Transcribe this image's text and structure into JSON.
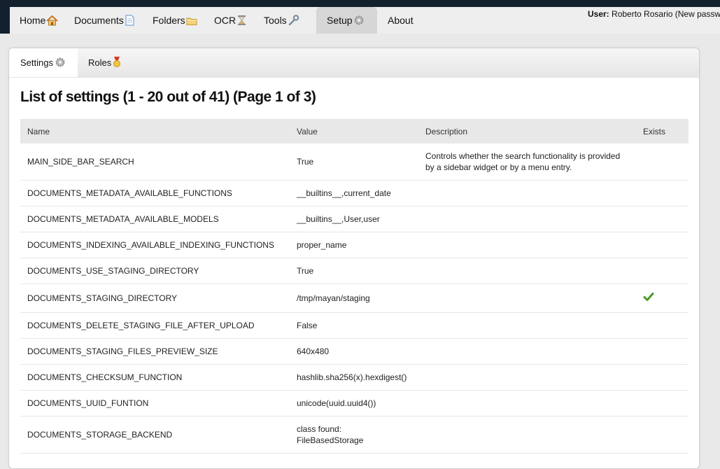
{
  "nav": {
    "items": [
      {
        "label": "Home",
        "icon": "home-icon"
      },
      {
        "label": "Documents",
        "icon": "document-icon"
      },
      {
        "label": "Folders",
        "icon": "folder-icon"
      },
      {
        "label": "OCR",
        "icon": "hourglass-icon"
      },
      {
        "label": "Tools",
        "icon": "wrench-icon"
      },
      {
        "label": "Setup",
        "icon": "gear-icon",
        "active": true
      },
      {
        "label": "About",
        "icon": ""
      }
    ]
  },
  "user": {
    "prefix": "User:",
    "name": "Roberto Rosario (New passw"
  },
  "tabs": [
    {
      "label": "Settings",
      "icon": "gear-icon",
      "active": true
    },
    {
      "label": "Roles",
      "icon": "medal-icon"
    }
  ],
  "title": "List of settings (1 - 20 out of 41) (Page 1 of 3)",
  "table": {
    "headers": [
      "Name",
      "Value",
      "Description",
      "Exists"
    ],
    "rows": [
      {
        "name": "MAIN_SIDE_BAR_SEARCH",
        "value": "True",
        "description": "Controls whether the search functionality is provided by a sidebar widget or by a menu entry.",
        "exists": false
      },
      {
        "name": "DOCUMENTS_METADATA_AVAILABLE_FUNCTIONS",
        "value": "__builtins__,current_date",
        "description": "",
        "exists": false
      },
      {
        "name": "DOCUMENTS_METADATA_AVAILABLE_MODELS",
        "value": "__builtins__,User,user",
        "description": "",
        "exists": false
      },
      {
        "name": "DOCUMENTS_INDEXING_AVAILABLE_INDEXING_FUNCTIONS",
        "value": "proper_name",
        "description": "",
        "exists": false
      },
      {
        "name": "DOCUMENTS_USE_STAGING_DIRECTORY",
        "value": "True",
        "description": "",
        "exists": false
      },
      {
        "name": "DOCUMENTS_STAGING_DIRECTORY",
        "value": "/tmp/mayan/staging",
        "description": "",
        "exists": true
      },
      {
        "name": "DOCUMENTS_DELETE_STAGING_FILE_AFTER_UPLOAD",
        "value": "False",
        "description": "",
        "exists": false
      },
      {
        "name": "DOCUMENTS_STAGING_FILES_PREVIEW_SIZE",
        "value": "640x480",
        "description": "",
        "exists": false
      },
      {
        "name": "DOCUMENTS_CHECKSUM_FUNCTION",
        "value": "hashlib.sha256(x).hexdigest()",
        "description": "",
        "exists": false
      },
      {
        "name": "DOCUMENTS_UUID_FUNTION",
        "value": "unicode(uuid.uuid4())",
        "description": "",
        "exists": false
      },
      {
        "name": "DOCUMENTS_STORAGE_BACKEND",
        "value": "class found:\nFileBasedStorage",
        "description": "",
        "exists": false
      }
    ]
  },
  "colors": {
    "topbar": "#13202e",
    "check": "#4a9a2a"
  }
}
